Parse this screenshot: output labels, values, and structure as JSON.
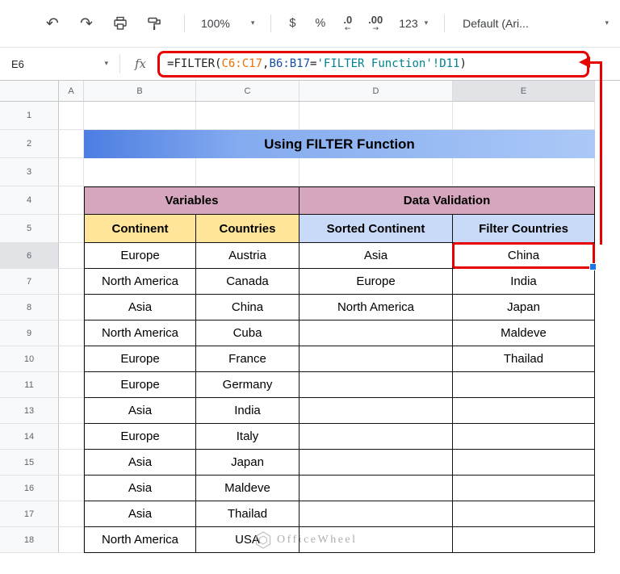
{
  "colors": {
    "annotation_red": "#e60000",
    "title_blue_left": "#4c7de2",
    "title_blue_right": "#abc8f7",
    "group_header_pink": "#d5a6bd",
    "subheader_tan": "#ffe599",
    "subheader_blue": "#c9daf8",
    "selection_handle_blue": "#1a73e8"
  },
  "toolbar": {
    "zoom": "100%",
    "currency": "$",
    "percent": "%",
    "decrease_decimal": ".0",
    "increase_decimal": ".00",
    "more_formats": "123",
    "font": "Default (Ari..."
  },
  "formula_bar": {
    "name_box": "E6",
    "fx_label": "fx",
    "formula_parts": [
      {
        "text": "=FILTER(",
        "color": "#202124"
      },
      {
        "text": "C6:C17",
        "color": "#e8710a"
      },
      {
        "text": ",",
        "color": "#202124"
      },
      {
        "text": "B6:B17",
        "color": "#174ea6"
      },
      {
        "text": "=",
        "color": "#202124"
      },
      {
        "text": "'FILTER Function'!D11",
        "color": "#00838f"
      },
      {
        "text": ")",
        "color": "#202124"
      }
    ]
  },
  "sheet": {
    "column_headers": [
      "A",
      "B",
      "C",
      "D",
      "E"
    ],
    "selected_cell": "E6",
    "selected_column": "E",
    "selected_row": "6",
    "rows": [
      {
        "n": "1",
        "cells": [
          {
            "cols": "A"
          },
          {
            "cols": "B"
          },
          {
            "cols": "C"
          },
          {
            "cols": "D"
          },
          {
            "cols": "E"
          }
        ]
      },
      {
        "n": "2",
        "cells": [
          {
            "cols": "A"
          },
          {
            "cols": "BCDE",
            "t": "Using FILTER Function",
            "cls": "title",
            "name": "table-title"
          }
        ]
      },
      {
        "n": "3",
        "cells": [
          {
            "cols": "A"
          },
          {
            "cols": "B"
          },
          {
            "cols": "C"
          },
          {
            "cols": "D"
          },
          {
            "cols": "E"
          }
        ]
      },
      {
        "n": "4",
        "cells": [
          {
            "cols": "A"
          },
          {
            "cols": "BC",
            "t": "Variables",
            "cls": "ghdr",
            "name": "group-header-variables"
          },
          {
            "cols": "DE",
            "t": "Data Validation",
            "cls": "ghdr",
            "name": "group-header-data-validation"
          }
        ]
      },
      {
        "n": "5",
        "cells": [
          {
            "cols": "A"
          },
          {
            "cols": "B",
            "t": "Continent",
            "cls": "chdr tan",
            "name": "column-label-continent"
          },
          {
            "cols": "C",
            "t": "Countries",
            "cls": "chdr tan",
            "name": "column-label-countries"
          },
          {
            "cols": "D",
            "t": "Sorted Continent",
            "cls": "chdr blu",
            "name": "column-label-sorted-continent"
          },
          {
            "cols": "E",
            "t": "Filter Countries",
            "cls": "chdr blu",
            "name": "column-label-filter-countries"
          }
        ]
      },
      {
        "n": "6",
        "cells": [
          {
            "cols": "A"
          },
          {
            "cols": "B",
            "t": "Europe",
            "cls": "d"
          },
          {
            "cols": "C",
            "t": "Austria",
            "cls": "d"
          },
          {
            "cols": "D",
            "t": "Asia",
            "cls": "d"
          },
          {
            "cols": "E",
            "t": "China",
            "cls": "d sel",
            "name": "selected-cell-E6"
          }
        ]
      },
      {
        "n": "7",
        "cells": [
          {
            "cols": "A"
          },
          {
            "cols": "B",
            "t": "North America",
            "cls": "d"
          },
          {
            "cols": "C",
            "t": "Canada",
            "cls": "d"
          },
          {
            "cols": "D",
            "t": "Europe",
            "cls": "d"
          },
          {
            "cols": "E",
            "t": "India",
            "cls": "d"
          }
        ]
      },
      {
        "n": "8",
        "cells": [
          {
            "cols": "A"
          },
          {
            "cols": "B",
            "t": "Asia",
            "cls": "d"
          },
          {
            "cols": "C",
            "t": "China",
            "cls": "d"
          },
          {
            "cols": "D",
            "t": "North America",
            "cls": "d"
          },
          {
            "cols": "E",
            "t": "Japan",
            "cls": "d"
          }
        ]
      },
      {
        "n": "9",
        "cells": [
          {
            "cols": "A"
          },
          {
            "cols": "B",
            "t": "North America",
            "cls": "d"
          },
          {
            "cols": "C",
            "t": "Cuba",
            "cls": "d"
          },
          {
            "cols": "D",
            "t": "",
            "cls": "d"
          },
          {
            "cols": "E",
            "t": "Maldeve",
            "cls": "d"
          }
        ]
      },
      {
        "n": "10",
        "cells": [
          {
            "cols": "A"
          },
          {
            "cols": "B",
            "t": "Europe",
            "cls": "d"
          },
          {
            "cols": "C",
            "t": "France",
            "cls": "d"
          },
          {
            "cols": "D",
            "t": "",
            "cls": "d"
          },
          {
            "cols": "E",
            "t": "Thailad",
            "cls": "d"
          }
        ]
      },
      {
        "n": "11",
        "cells": [
          {
            "cols": "A"
          },
          {
            "cols": "B",
            "t": "Europe",
            "cls": "d"
          },
          {
            "cols": "C",
            "t": "Germany",
            "cls": "d"
          },
          {
            "cols": "D",
            "t": "",
            "cls": "d"
          },
          {
            "cols": "E",
            "t": "",
            "cls": "d"
          }
        ]
      },
      {
        "n": "13",
        "cells": [
          {
            "cols": "A"
          },
          {
            "cols": "B",
            "t": "Asia",
            "cls": "d"
          },
          {
            "cols": "C",
            "t": "India",
            "cls": "d"
          },
          {
            "cols": "D",
            "t": "",
            "cls": "d"
          },
          {
            "cols": "E",
            "t": "",
            "cls": "d"
          }
        ]
      },
      {
        "n": "14",
        "cells": [
          {
            "cols": "A"
          },
          {
            "cols": "B",
            "t": "Europe",
            "cls": "d"
          },
          {
            "cols": "C",
            "t": "Italy",
            "cls": "d"
          },
          {
            "cols": "D",
            "t": "",
            "cls": "d"
          },
          {
            "cols": "E",
            "t": "",
            "cls": "d"
          }
        ]
      },
      {
        "n": "15",
        "cells": [
          {
            "cols": "A"
          },
          {
            "cols": "B",
            "t": "Asia",
            "cls": "d"
          },
          {
            "cols": "C",
            "t": "Japan",
            "cls": "d"
          },
          {
            "cols": "D",
            "t": "",
            "cls": "d"
          },
          {
            "cols": "E",
            "t": "",
            "cls": "d"
          }
        ]
      },
      {
        "n": "16",
        "cells": [
          {
            "cols": "A"
          },
          {
            "cols": "B",
            "t": "Asia",
            "cls": "d"
          },
          {
            "cols": "C",
            "t": "Maldeve",
            "cls": "d"
          },
          {
            "cols": "D",
            "t": "",
            "cls": "d"
          },
          {
            "cols": "E",
            "t": "",
            "cls": "d"
          }
        ]
      },
      {
        "n": "17",
        "cells": [
          {
            "cols": "A"
          },
          {
            "cols": "B",
            "t": "Asia",
            "cls": "d"
          },
          {
            "cols": "C",
            "t": "Thailad",
            "cls": "d"
          },
          {
            "cols": "D",
            "t": "",
            "cls": "d"
          },
          {
            "cols": "E",
            "t": "",
            "cls": "d"
          }
        ]
      },
      {
        "n": "18",
        "cells": [
          {
            "cols": "A"
          },
          {
            "cols": "B",
            "t": "North America",
            "cls": "d"
          },
          {
            "cols": "C",
            "t": "USA",
            "cls": "d"
          },
          {
            "cols": "D",
            "t": "",
            "cls": "d"
          },
          {
            "cols": "E",
            "t": "",
            "cls": "d"
          }
        ]
      }
    ]
  },
  "watermark": {
    "text": "OfficeWheel"
  }
}
